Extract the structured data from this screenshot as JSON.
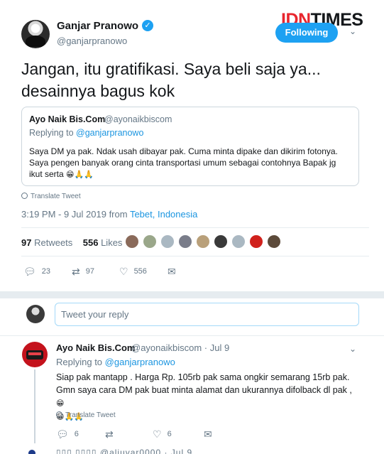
{
  "brand": {
    "logo_part1": "IDN",
    "logo_part2": "TIMES"
  },
  "author": {
    "name": "Ganjar Pranowo",
    "handle": "@ganjarpranowo",
    "follow_label": "Following",
    "verified_mark": "✓"
  },
  "tweet": {
    "text": "Jangan, itu gratifikasi. Saya beli saja ya... desainnya bagus kok",
    "translate_label": "Translate Tweet",
    "time": "3:19 PM - 9 Jul 2019 from ",
    "location": "Tebet, Indonesia",
    "retweets_count": "97",
    "retweets_label": "Retweets",
    "likes_count": "556",
    "likes_label": "Likes",
    "actions": {
      "replies": "23",
      "retweets": "97",
      "likes": "556"
    }
  },
  "quoted": {
    "name": "Ayo Naik Bis.Com",
    "handle": "@ayonaikbiscom",
    "replying_prefix": "Replying to ",
    "replying_to": "@ganjarpranowo",
    "body_line1": "Saya DM ya pak. Ndak usah dibayar pak. Cuma minta dipake dan dikirim fotonya.",
    "body_line2": "Saya pengen banyak orang cinta transportasi umum sebagai contohnya Bapak jg",
    "body_line3": "ikut serta",
    "emojis": "😁🙏🙏"
  },
  "reply_box": {
    "placeholder": "Tweet your reply"
  },
  "reply": {
    "name": "Ayo Naik Bis.Com",
    "handle": "@ayonaikbiscom · Jul 9",
    "replying_prefix": "Replying to ",
    "replying_to": "@ganjarpranowo",
    "body_line1": "Siap pak mantapp . Harga Rp. 105rb pak sama ongkir semarang 15rb pak.",
    "body_line2": "Gmn saya cara DM pak buat minta alamat dan ukurannya difolback dl pak ,",
    "emojis_inline": "😁",
    "emojis_line3": "😁🙏🙏",
    "translate_label": "Translate Tweet",
    "actions": {
      "replies": "6",
      "retweets": "",
      "likes": "6"
    }
  },
  "next_reply": {
    "preview": "▯▯▯ ▯▯▯▯  @aljuvar0000 · Jul 9"
  },
  "colors": {
    "accent": "#1da1f2",
    "brand_red": "#e8262e",
    "muted": "#657786"
  },
  "icons": [
    "verified-icon",
    "chevron-down-icon",
    "globe-icon",
    "reply-icon",
    "retweet-icon",
    "like-icon",
    "message-icon"
  ]
}
